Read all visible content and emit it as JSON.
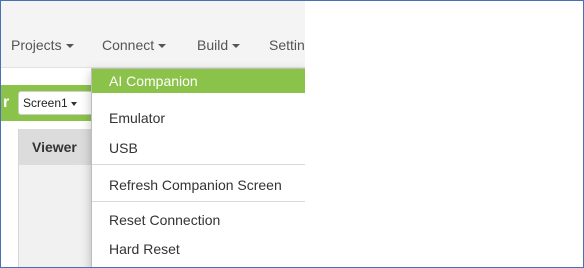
{
  "menubar": {
    "projects": "Projects",
    "connect": "Connect",
    "build": "Build",
    "settings": "Settin"
  },
  "toolbar": {
    "letter": "r",
    "screen_select": "Screen1"
  },
  "viewer": {
    "title": "Viewer"
  },
  "connect_menu": {
    "items": [
      {
        "label": "AI Companion",
        "active": true
      },
      {
        "label": "Emulator"
      },
      {
        "label": "USB"
      },
      {
        "label": "Refresh Companion Screen"
      },
      {
        "label": "Reset Connection"
      },
      {
        "label": "Hard Reset"
      }
    ]
  },
  "colors": {
    "accent": "#8bc34a",
    "frame_border": "#4a6fb5"
  }
}
